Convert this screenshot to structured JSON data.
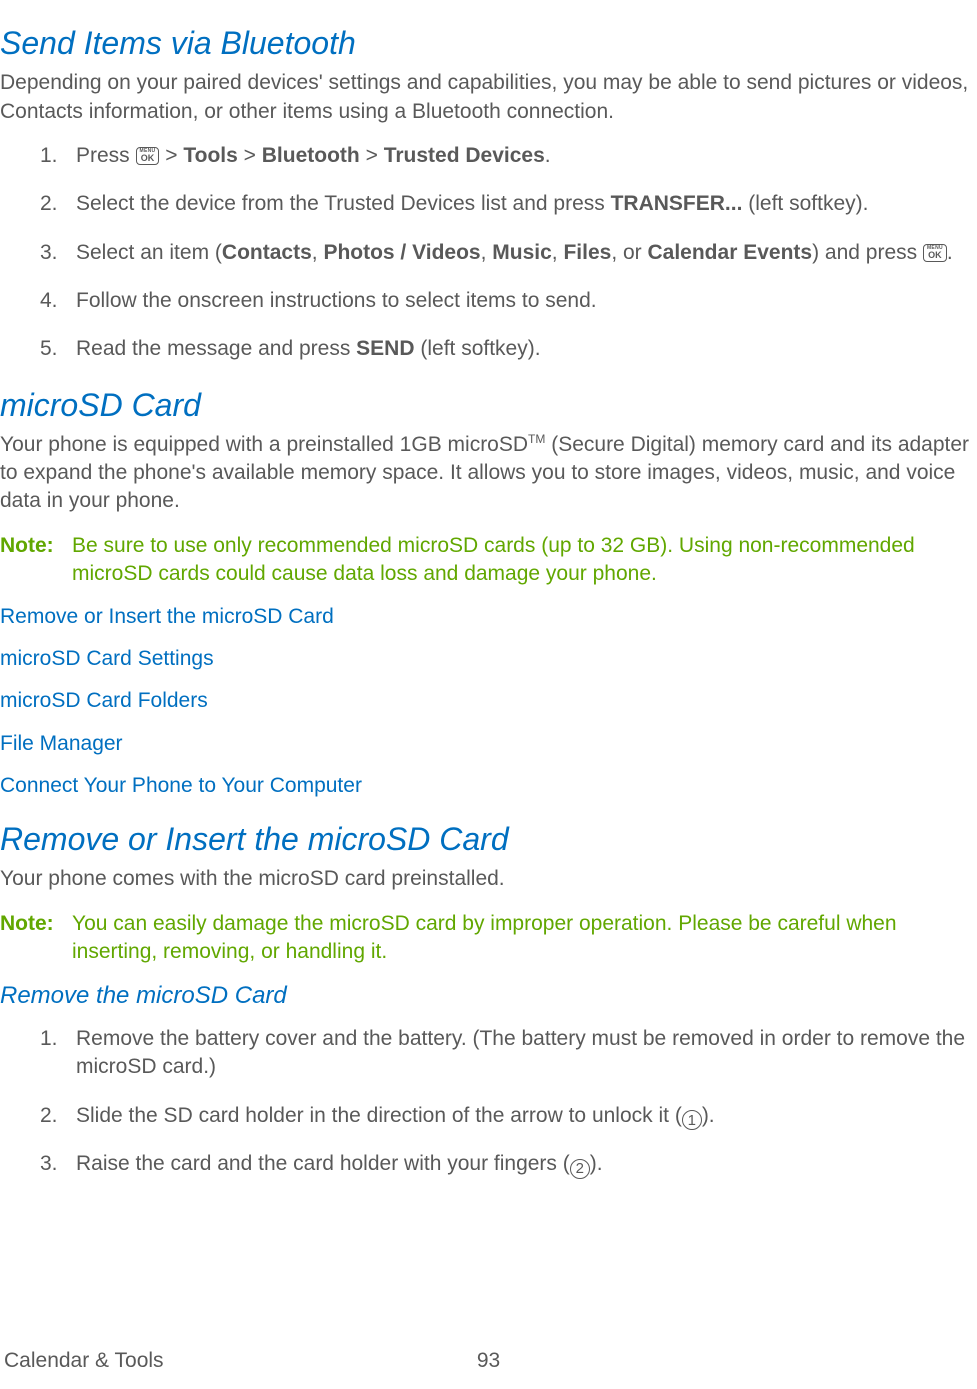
{
  "section1": {
    "title": "Send Items via Bluetooth",
    "intro": "Depending on your paired devices' settings and capabilities, you may be able to send pictures or videos, Contacts information, or other items using a Bluetooth connection.",
    "steps": {
      "s1": {
        "num": "1.",
        "a": "Press ",
        "b": " > ",
        "tools": "Tools",
        "c": " > ",
        "bluetooth": "Bluetooth",
        "d": " > ",
        "trusted": "Trusted Devices",
        "e": "."
      },
      "s2": {
        "num": "2.",
        "a": "Select the device from the Trusted Devices list and press ",
        "transfer": "TRANSFER...",
        "b": " (left softkey)."
      },
      "s3": {
        "num": "3.",
        "a": "Select an item (",
        "contacts": "Contacts",
        "b": ", ",
        "photos": "Photos / Videos",
        "c": ", ",
        "music": "Music",
        "d": ", ",
        "files": "Files",
        "e": ", or ",
        "calendar": "Calendar Events",
        "f": ") and press ",
        "g": "."
      },
      "s4": {
        "num": "4.",
        "text": "Follow the onscreen instructions to select items to send."
      },
      "s5": {
        "num": "5.",
        "a": "Read the message and press ",
        "send": "SEND",
        "b": " (left softkey)."
      }
    }
  },
  "section2": {
    "title": "microSD Card",
    "intro_a": "Your phone is equipped with a preinstalled 1GB microSD",
    "tm": "TM",
    "intro_b": " (Secure Digital) memory card and its adapter to expand the phone's available memory space. It allows you to store images, videos, music, and voice data in your phone.",
    "note_label": "Note:",
    "note_text": "Be sure to use only recommended microSD cards (up to 32 GB). Using non-recommended microSD cards could cause data loss and damage your phone.",
    "links": {
      "l1": "Remove or Insert the microSD Card",
      "l2": "microSD Card Settings",
      "l3": "microSD Card Folders",
      "l4": "File Manager",
      "l5": "Connect Your Phone to Your Computer"
    }
  },
  "section3": {
    "title": "Remove or Insert the microSD Card",
    "intro": "Your phone comes with the microSD card preinstalled.",
    "note_label": "Note:",
    "note_text": "You can easily damage the microSD card by improper operation. Please be careful when inserting, removing, or handling it.",
    "sub_title": "Remove the microSD Card",
    "steps": {
      "s1": {
        "num": "1.",
        "text": "Remove the battery cover and the battery. (The battery must be removed in order to remove the microSD card.)"
      },
      "s2": {
        "num": "2.",
        "a": "Slide the SD card holder in the direction of the arrow to unlock it (",
        "n": "1",
        "b": ")."
      },
      "s3": {
        "num": "3.",
        "a": "Raise the card and the card holder with your fingers (",
        "n": "2",
        "b": ")."
      }
    }
  },
  "footer": {
    "left": "Calendar & Tools",
    "page": "93"
  },
  "icons": {
    "menu_top": "MENU",
    "menu_ok": "OK"
  }
}
